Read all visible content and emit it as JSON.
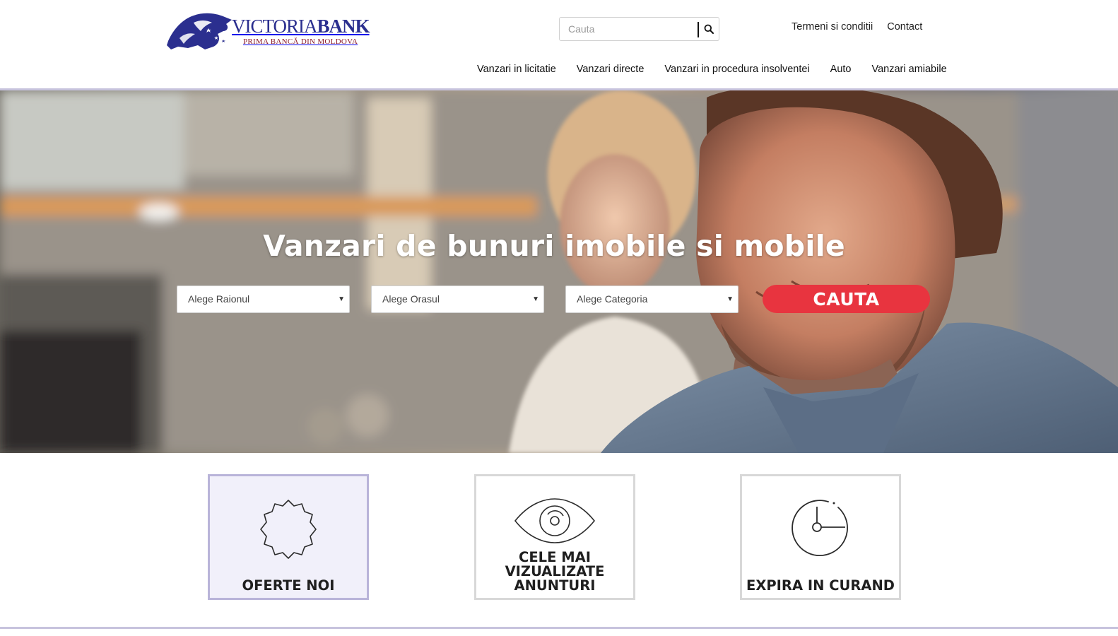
{
  "brand": {
    "name_light": "VICTORIA",
    "name_bold": "BANK",
    "tagline": "PRIMA BANCĂ DIN MOLDOVA",
    "primary_color": "#2b2f8f",
    "accent_color": "#8b1c2c"
  },
  "search": {
    "placeholder": "Cauta",
    "icon": "search-icon"
  },
  "top_links": [
    {
      "label": "Termeni si conditii"
    },
    {
      "label": "Contact"
    }
  ],
  "nav": [
    {
      "label": "Vanzari in licitatie"
    },
    {
      "label": "Vanzari directe"
    },
    {
      "label": "Vanzari in procedura insolventei"
    },
    {
      "label": "Auto"
    },
    {
      "label": "Vanzari amiabile"
    }
  ],
  "hero": {
    "title": "Vanzari de bunuri imobile si mobile",
    "filters": [
      {
        "selected": "Alege Raionul"
      },
      {
        "selected": "Alege Orasul"
      },
      {
        "selected": "Alege Categoria"
      }
    ],
    "submit_label": "CAUTA",
    "submit_color": "#e8343f"
  },
  "cards": [
    {
      "label": "OFERTE NOI",
      "icon": "badge-icon",
      "active": true
    },
    {
      "label_lines": [
        "CELE MAI",
        "VIZUALIZATE",
        "ANUNTURI"
      ],
      "icon": "eye-icon",
      "active": false
    },
    {
      "label": "EXPIRA IN CURAND",
      "icon": "clock-icon",
      "active": false
    }
  ]
}
